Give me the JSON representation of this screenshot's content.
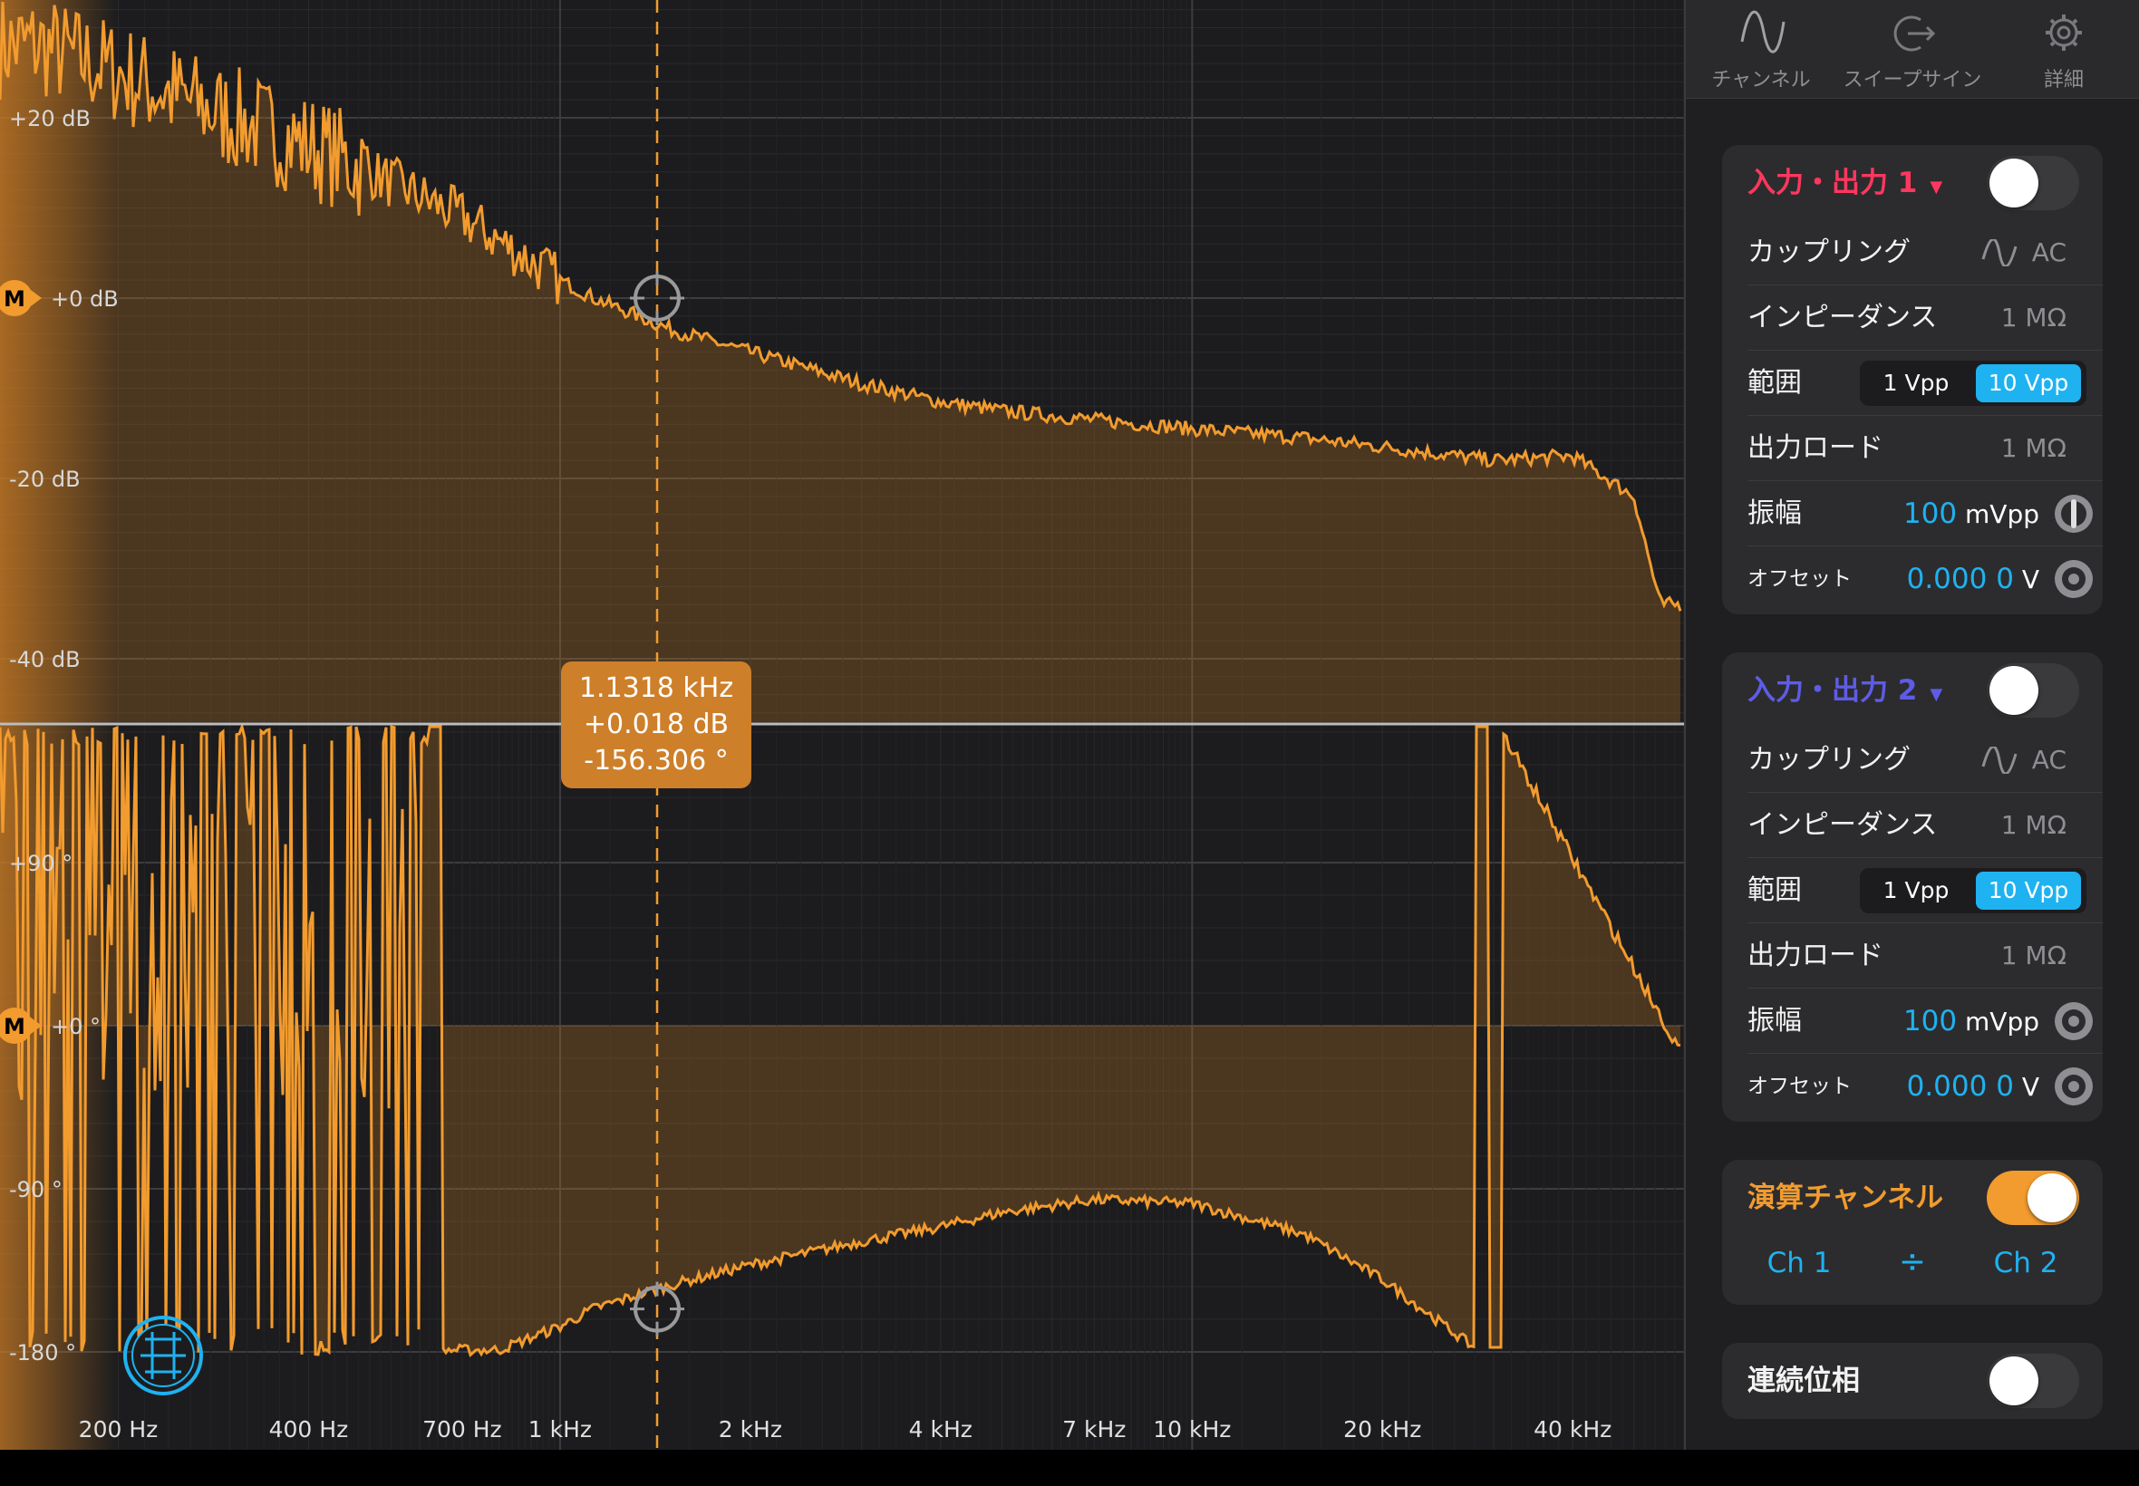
{
  "plot": {
    "mag_labels": [
      "+20 dB",
      "+0 dB",
      "-20 dB",
      "-40 dB"
    ],
    "phase_labels": [
      "+90 °",
      "+0 °",
      "-90 °",
      "-180 °"
    ],
    "freq_labels": [
      "200 Hz",
      "400 Hz",
      "700 Hz",
      "1 kHz",
      "2 kHz",
      "4 kHz",
      "7 kHz",
      "10 kHz",
      "20 kHz",
      "40 kHz"
    ],
    "marker_letter": "M",
    "cursor": {
      "freq": "1.1318 kHz",
      "mag": "+0.018 dB",
      "phase": "-156.306 °"
    },
    "trace_color": "#f29b2e"
  },
  "chart_data": [
    {
      "type": "line",
      "title": "",
      "xlabel": "",
      "ylabel": "",
      "x_scale": "log",
      "xlim_hz": [
        130,
        60000
      ],
      "ylim_db": [
        -50,
        32
      ],
      "x": [
        150,
        200,
        300,
        400,
        500,
        700,
        1000,
        1132,
        1500,
        2000,
        3000,
        4000,
        5000,
        7000,
        10000,
        15000,
        20000,
        30000,
        40000,
        50000,
        55000
      ],
      "series": [
        {
          "values": [
            28,
            25,
            20,
            17,
            14,
            9,
            2,
            0,
            -3.5,
            -6,
            -9.5,
            -11.5,
            -12.5,
            -13.5,
            -14.5,
            -15.5,
            -16.5,
            -18,
            -17.5,
            -22,
            -34
          ]
        }
      ]
    },
    {
      "type": "line",
      "title": "",
      "xlabel": "",
      "ylabel": "",
      "x_scale": "log",
      "xlim_hz": [
        130,
        60000
      ],
      "ylim_deg": [
        -200,
        170
      ],
      "x": [
        700,
        800,
        1000,
        1132,
        1500,
        2000,
        3000,
        4000,
        5000,
        7000,
        10000,
        15000,
        20000,
        28000
      ],
      "series": [
        {
          "values": [
            -179,
            -179,
            -166,
            -156,
            -143,
            -132,
            -119,
            -111,
            -103,
            -96,
            -98,
            -115,
            -140,
            -178
          ]
        }
      ]
    }
  ],
  "panel": {
    "tabs": [
      {
        "label": "チャンネル",
        "icon": "sine-wave-icon"
      },
      {
        "label": "スイープサイン",
        "icon": "output-arrow-icon"
      },
      {
        "label": "詳細",
        "icon": "gear-icon"
      }
    ],
    "ch1": {
      "title": "入力・出力 1",
      "color": "#ff375f",
      "coupling_label": "カップリング",
      "coupling_value": "AC",
      "impedance_label": "インピーダンス",
      "impedance_value": "1 MΩ",
      "range_label": "範囲",
      "range_options": [
        "1 Vpp",
        "10 Vpp"
      ],
      "range_selected": "10 Vpp",
      "load_label": "出力ロード",
      "load_value": "1 MΩ",
      "amp_label": "振幅",
      "amp_value": "100",
      "amp_unit": "mVpp",
      "offset_label": "オフセット",
      "offset_value": "0.000 0",
      "offset_unit": "V",
      "enabled": false
    },
    "ch2": {
      "title": "入力・出力 2",
      "color": "#5e5ce6",
      "coupling_label": "カップリング",
      "coupling_value": "AC",
      "impedance_label": "インピーダンス",
      "impedance_value": "1 MΩ",
      "range_label": "範囲",
      "range_options": [
        "1 Vpp",
        "10 Vpp"
      ],
      "range_selected": "10 Vpp",
      "load_label": "出力ロード",
      "load_value": "1 MΩ",
      "amp_label": "振幅",
      "amp_value": "100",
      "amp_unit": "mVpp",
      "offset_label": "オフセット",
      "offset_value": "0.000 0",
      "offset_unit": "V",
      "enabled": false
    },
    "math": {
      "title": "演算チャンネル",
      "color": "#f29b2e",
      "a": "Ch 1",
      "op": "÷",
      "b": "Ch 2",
      "enabled": true
    },
    "continuous_phase": {
      "title": "連続位相",
      "enabled": false
    }
  }
}
